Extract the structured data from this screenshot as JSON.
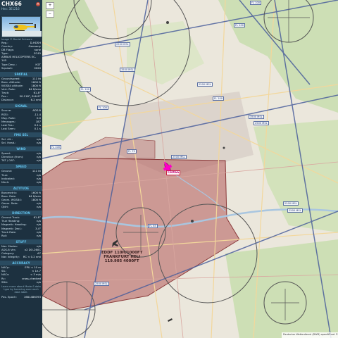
{
  "panel": {
    "callsign": "CHX66",
    "hex_line": "Hex: 3E1216",
    "photo_credit": "Image © Daniel Schwarz",
    "details": [
      {
        "k": "Reg.:",
        "v": "D-HDSH"
      },
      {
        "k": "Country:",
        "v": "Germany"
      },
      {
        "k": "DB Flags:",
        "v": "none"
      },
      {
        "k": "Type:",
        "v": "EC45"
      },
      {
        "k": "",
        "v": "AIRBUS HELICOPTERS EC-145"
      },
      {
        "k": "Type Desc.:",
        "v": "H2T"
      },
      {
        "k": "Squawk:",
        "v": "0020"
      }
    ],
    "sections": [
      {
        "title": "SPATIAL",
        "rows": [
          {
            "k": "Groundspeed:",
            "v": "111 kt"
          },
          {
            "k": "Baro. Altitude:",
            "v": "1600 ft"
          },
          {
            "k": "WGS84 altitude:",
            "v": "1800 ft"
          },
          {
            "k": "Vert. Rate:",
            "v": "64 ft/min"
          },
          {
            "k": "Track:",
            "v": "61.8°"
          },
          {
            "k": "Pos.:",
            "v": "50.118°, 8.649°"
          },
          {
            "k": "Distance:",
            "v": "6.2 nmi"
          }
        ]
      },
      {
        "title": "SIGNAL",
        "rows": [
          {
            "k": "Source:",
            "v": "ADS-B"
          },
          {
            "k": "RSSI:",
            "v": "-11.4"
          },
          {
            "k": "Msg. Rate:",
            "v": "0.0"
          },
          {
            "k": "Messages:",
            "v": "187"
          },
          {
            "k": "Last Pos.:",
            "v": "0.1 s"
          },
          {
            "k": "Last Seen:",
            "v": "0.1 s"
          }
        ]
      },
      {
        "title": "FMS SEL",
        "rows": [
          {
            "k": "Sel. Alt.:",
            "v": "n/a"
          },
          {
            "k": "Sel. Head.:",
            "v": "n/a"
          }
        ]
      },
      {
        "title": "WIND",
        "rows": [
          {
            "k": "Speed:",
            "v": "n/a"
          },
          {
            "k": "Direction (from):",
            "v": "n/a"
          },
          {
            "k": "TAT / OAT:",
            "v": "n/a"
          }
        ]
      },
      {
        "title": "SPEED",
        "rows": [
          {
            "k": "Ground:",
            "v": "111 kt"
          },
          {
            "k": "True:",
            "v": "n/a"
          },
          {
            "k": "Indicated:",
            "v": "n/a"
          },
          {
            "k": "Mach:",
            "v": "n/a"
          }
        ]
      },
      {
        "title": "ALTITUDE",
        "rows": [
          {
            "k": "Barometric:",
            "v": "1600 ft"
          },
          {
            "k": "Baro. Rate:",
            "v": "64 ft/min"
          },
          {
            "k": "Geom. WGS84:",
            "v": "1800 ft"
          },
          {
            "k": "Geom. Rate:",
            "v": "n/a"
          },
          {
            "k": "QNH:",
            "v": "n/a"
          }
        ]
      },
      {
        "title": "DIRECTION",
        "rows": [
          {
            "k": "Ground Track:",
            "v": "61.8°"
          },
          {
            "k": "True Heading:",
            "v": "n/a"
          },
          {
            "k": "Magnetic Heading:",
            "v": "n/a"
          },
          {
            "k": "Magnetic Decl.:",
            "v": "3.4°"
          },
          {
            "k": "Track Rate:",
            "v": "n/a"
          },
          {
            "k": "Roll:",
            "v": "n/a"
          }
        ]
      },
      {
        "title": "STUFF",
        "rows": [
          {
            "k": "Nav. Modes:",
            "v": "n/a"
          },
          {
            "k": "ADS-B Ver.:",
            "v": "v2 DO-260C"
          },
          {
            "k": "Category:",
            "v": "A7"
          },
          {
            "k": "Nav Integrity:",
            "v": "RC < 0.2 nmi"
          }
        ]
      },
      {
        "title": "ACCURACY",
        "rows": [
          {
            "k": "NACp:",
            "v": "EPU < 10 m"
          },
          {
            "k": "SIL:",
            "v": "< 1e-7"
          },
          {
            "k": "NACv:",
            "v": "< 3 m/s"
          },
          {
            "k": "Rc:",
            "v": "cross-checked"
          },
          {
            "k": "SDA:",
            "v": "n/a"
          }
        ]
      }
    ],
    "footer": "Learn more about Mode-S data type by hovering over each data label.",
    "bottom_row": {
      "k": "Pos. Epoch:",
      "v": "1681486393"
    }
  },
  "map": {
    "zoom_in": "+",
    "zoom_out": "−",
    "aircraft_label": "CHX66",
    "airport_lines": [
      "EDDF 110H/1000FT",
      "FRANKFURT HELI",
      "119.905 4000FT"
    ],
    "small_labels": [
      "FL 100",
      "FL 100",
      "2500 MSL",
      "FL 100",
      "3500 MSL",
      "2500 MSL",
      "FL 100",
      "3500 MSL",
      "FL 100",
      "2500 MSL",
      "FL 100",
      "FL 75",
      "2500 MSL",
      "2500 MSL",
      "2500 MSL",
      "FL 65",
      "2500 MSL"
    ],
    "attribution": "Deutscher Wetterdienst (DWD) openAIP.net © OpenStreetMap contributors",
    "accent_color": "#ff00c8",
    "zone_color": "#b25a5a"
  }
}
